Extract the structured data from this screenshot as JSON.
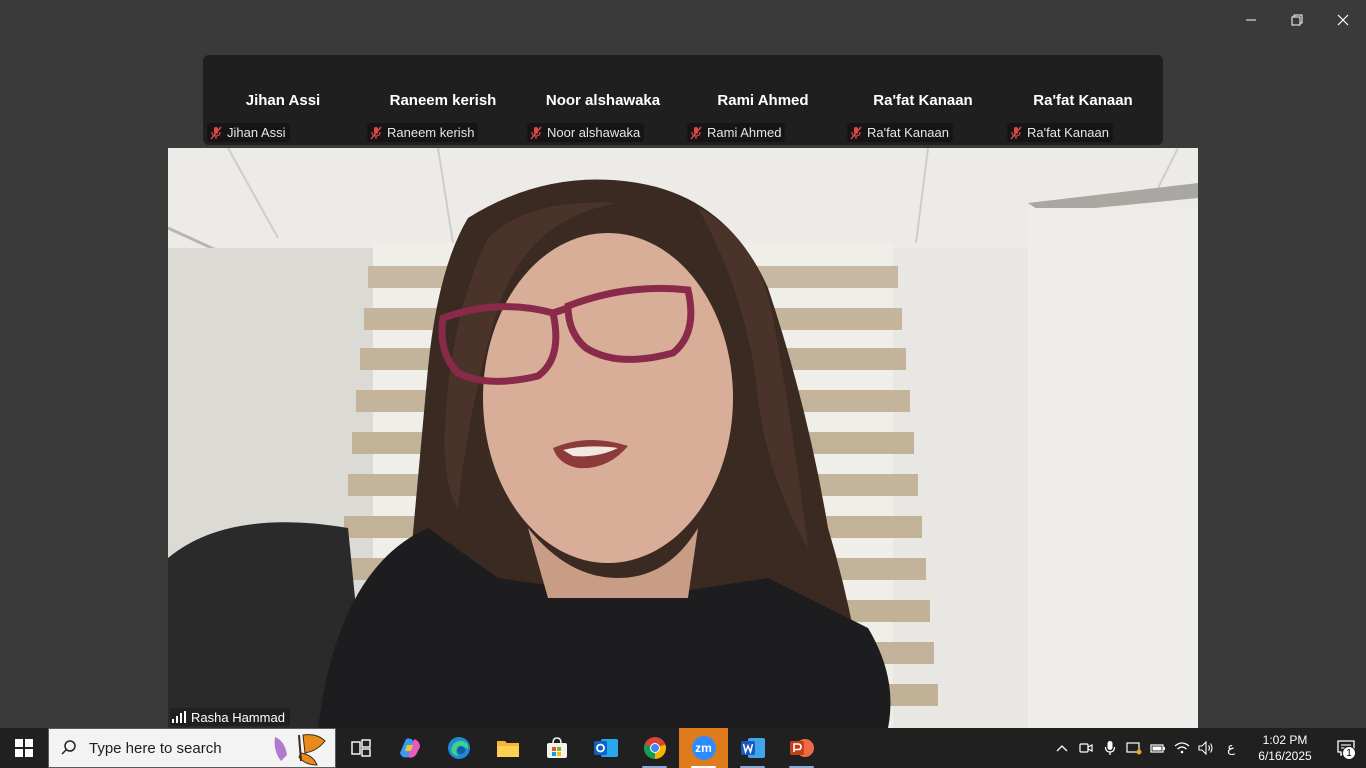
{
  "window": {
    "controls": [
      "minimize",
      "restore",
      "close"
    ]
  },
  "participants": [
    {
      "name": "Jihan Assi",
      "label": "Jihan Assi",
      "muted": true
    },
    {
      "name": "Raneem kerish",
      "label": "Raneem kerish",
      "muted": true
    },
    {
      "name": "Noor alshawaka",
      "label": "Noor alshawaka",
      "muted": true
    },
    {
      "name": "Rami Ahmed",
      "label": "Rami Ahmed",
      "muted": true
    },
    {
      "name": "Ra'fat Kanaan",
      "label": "Ra'fat Kanaan",
      "muted": true
    },
    {
      "name": "Ra'fat Kanaan",
      "label": "Ra'fat Kanaan",
      "muted": true
    }
  ],
  "active_speaker": {
    "name": "Rasha Hammad"
  },
  "taskbar": {
    "search_placeholder": "Type here to search",
    "apps": [
      "task-view",
      "copilot",
      "edge",
      "file-explorer",
      "microsoft-store",
      "outlook",
      "chrome",
      "zoom",
      "word",
      "powerpoint"
    ],
    "zoom_label": "zm",
    "language": "ع",
    "time": "1:02 PM",
    "date": "6/16/2025",
    "notification_count": "1"
  },
  "colors": {
    "background": "#3a3a3a",
    "strip": "#1f1f1f",
    "mute_red": "#e04848",
    "zoom_orange": "#e07b1c",
    "taskbar": "#202020"
  }
}
